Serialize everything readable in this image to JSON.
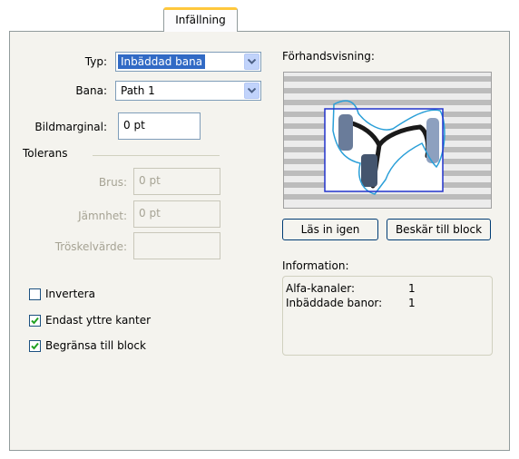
{
  "tab": {
    "label": "Infällning"
  },
  "form": {
    "typ_label": "Typ:",
    "typ_value": "Inbäddad bana",
    "bana_label": "Bana:",
    "bana_value": "Path 1",
    "bildmarginal_label": "Bildmarginal:",
    "bildmarginal_value": "0 pt",
    "tolerans_label": "Tolerans",
    "brus_label": "Brus:",
    "brus_value": "0 pt",
    "jamnhet_label": "Jämnhet:",
    "jamnhet_value": "0 pt",
    "troskelvarde_label": "Tröskelvärde:",
    "troskelvarde_value": ""
  },
  "options": {
    "invertera": {
      "label": "Invertera",
      "checked": false
    },
    "endast_yttre": {
      "label": "Endast yttre kanter",
      "checked": true
    },
    "begransa": {
      "label": "Begränsa till block",
      "checked": true
    }
  },
  "preview": {
    "label": "Förhandsvisning:"
  },
  "buttons": {
    "reload": "Läs in igen",
    "crop": "Beskär till block"
  },
  "info": {
    "label": "Information:",
    "rows": [
      {
        "key": "Alfa-kanaler:",
        "value": "1"
      },
      {
        "key": "Inbäddade banor:",
        "value": "1"
      }
    ]
  },
  "colors": {
    "selection": "#316ac5",
    "panel": "#f4f3ee",
    "frame_blue": "#2233cc",
    "path_cyan": "#2a9fd8"
  }
}
